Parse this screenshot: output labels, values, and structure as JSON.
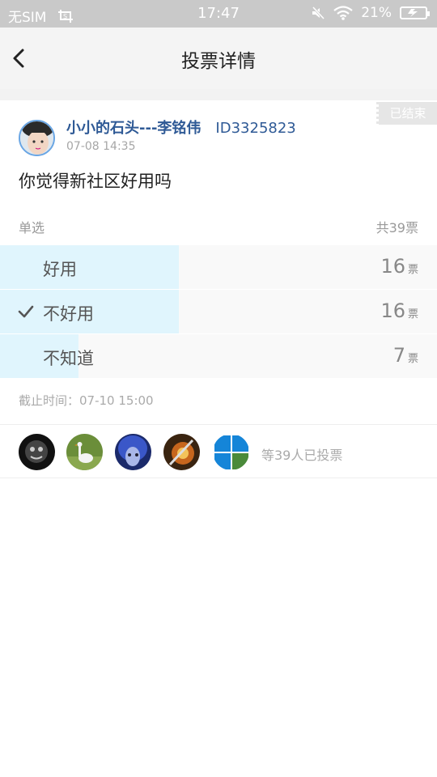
{
  "status_bar": {
    "carrier": "无SIM",
    "time": "17:47",
    "battery": "21%",
    "icons": [
      "screenshot-icon",
      "mute-icon",
      "wifi-icon",
      "battery-icon"
    ]
  },
  "header": {
    "title": "投票详情",
    "back_icon": "chevron-left-icon"
  },
  "post": {
    "ended_badge": "已结束",
    "author": "小小的石头---李铭伟",
    "author_id": "ID3325823",
    "time": "07-08 14:35",
    "question": "你觉得新社区好用吗"
  },
  "poll": {
    "type_label": "单选",
    "total_label": "共39票",
    "unit": "票",
    "options": [
      {
        "label": "好用",
        "votes": "16",
        "share": 0.41,
        "selected": false
      },
      {
        "label": "不好用",
        "votes": "16",
        "share": 0.41,
        "selected": true
      },
      {
        "label": "不知道",
        "votes": "7",
        "share": 0.18,
        "selected": false
      }
    ],
    "deadline": "截止时间：07-10 15:00"
  },
  "voters": {
    "summary": "等39人已投票",
    "colors": {
      "accent_name": "#2f5a96",
      "fill_bar": "#e0f5fd"
    }
  }
}
